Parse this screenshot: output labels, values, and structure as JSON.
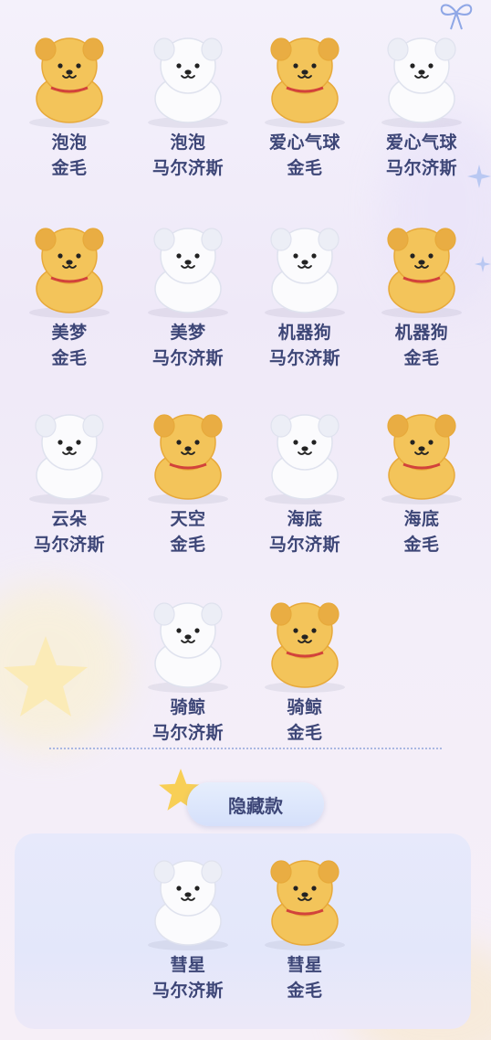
{
  "colors": {
    "label": "#3d4677",
    "golden": "#f3c45a",
    "white_dog": "#fbfbfd"
  },
  "figures": [
    {
      "line1": "泡泡",
      "line2": "金毛",
      "type": "golden"
    },
    {
      "line1": "泡泡",
      "line2": "马尔济斯",
      "type": "white"
    },
    {
      "line1": "爱心气球",
      "line2": "金毛",
      "type": "golden"
    },
    {
      "line1": "爱心气球",
      "line2": "马尔济斯",
      "type": "white"
    },
    {
      "line1": "美梦",
      "line2": "金毛",
      "type": "golden"
    },
    {
      "line1": "美梦",
      "line2": "马尔济斯",
      "type": "white"
    },
    {
      "line1": "机器狗",
      "line2": "马尔济斯",
      "type": "white"
    },
    {
      "line1": "机器狗",
      "line2": "金毛",
      "type": "golden"
    },
    {
      "line1": "云朵",
      "line2": "马尔济斯",
      "type": "white"
    },
    {
      "line1": "天空",
      "line2": "金毛",
      "type": "golden"
    },
    {
      "line1": "海底",
      "line2": "马尔济斯",
      "type": "white"
    },
    {
      "line1": "海底",
      "line2": "金毛",
      "type": "golden"
    },
    {
      "line1": "骑鲸",
      "line2": "马尔济斯",
      "type": "white"
    },
    {
      "line1": "骑鲸",
      "line2": "金毛",
      "type": "golden"
    }
  ],
  "hidden_section": {
    "title": "隐藏款",
    "figures": [
      {
        "line1": "彗星",
        "line2": "马尔济斯",
        "type": "white"
      },
      {
        "line1": "彗星",
        "line2": "金毛",
        "type": "golden"
      }
    ]
  }
}
